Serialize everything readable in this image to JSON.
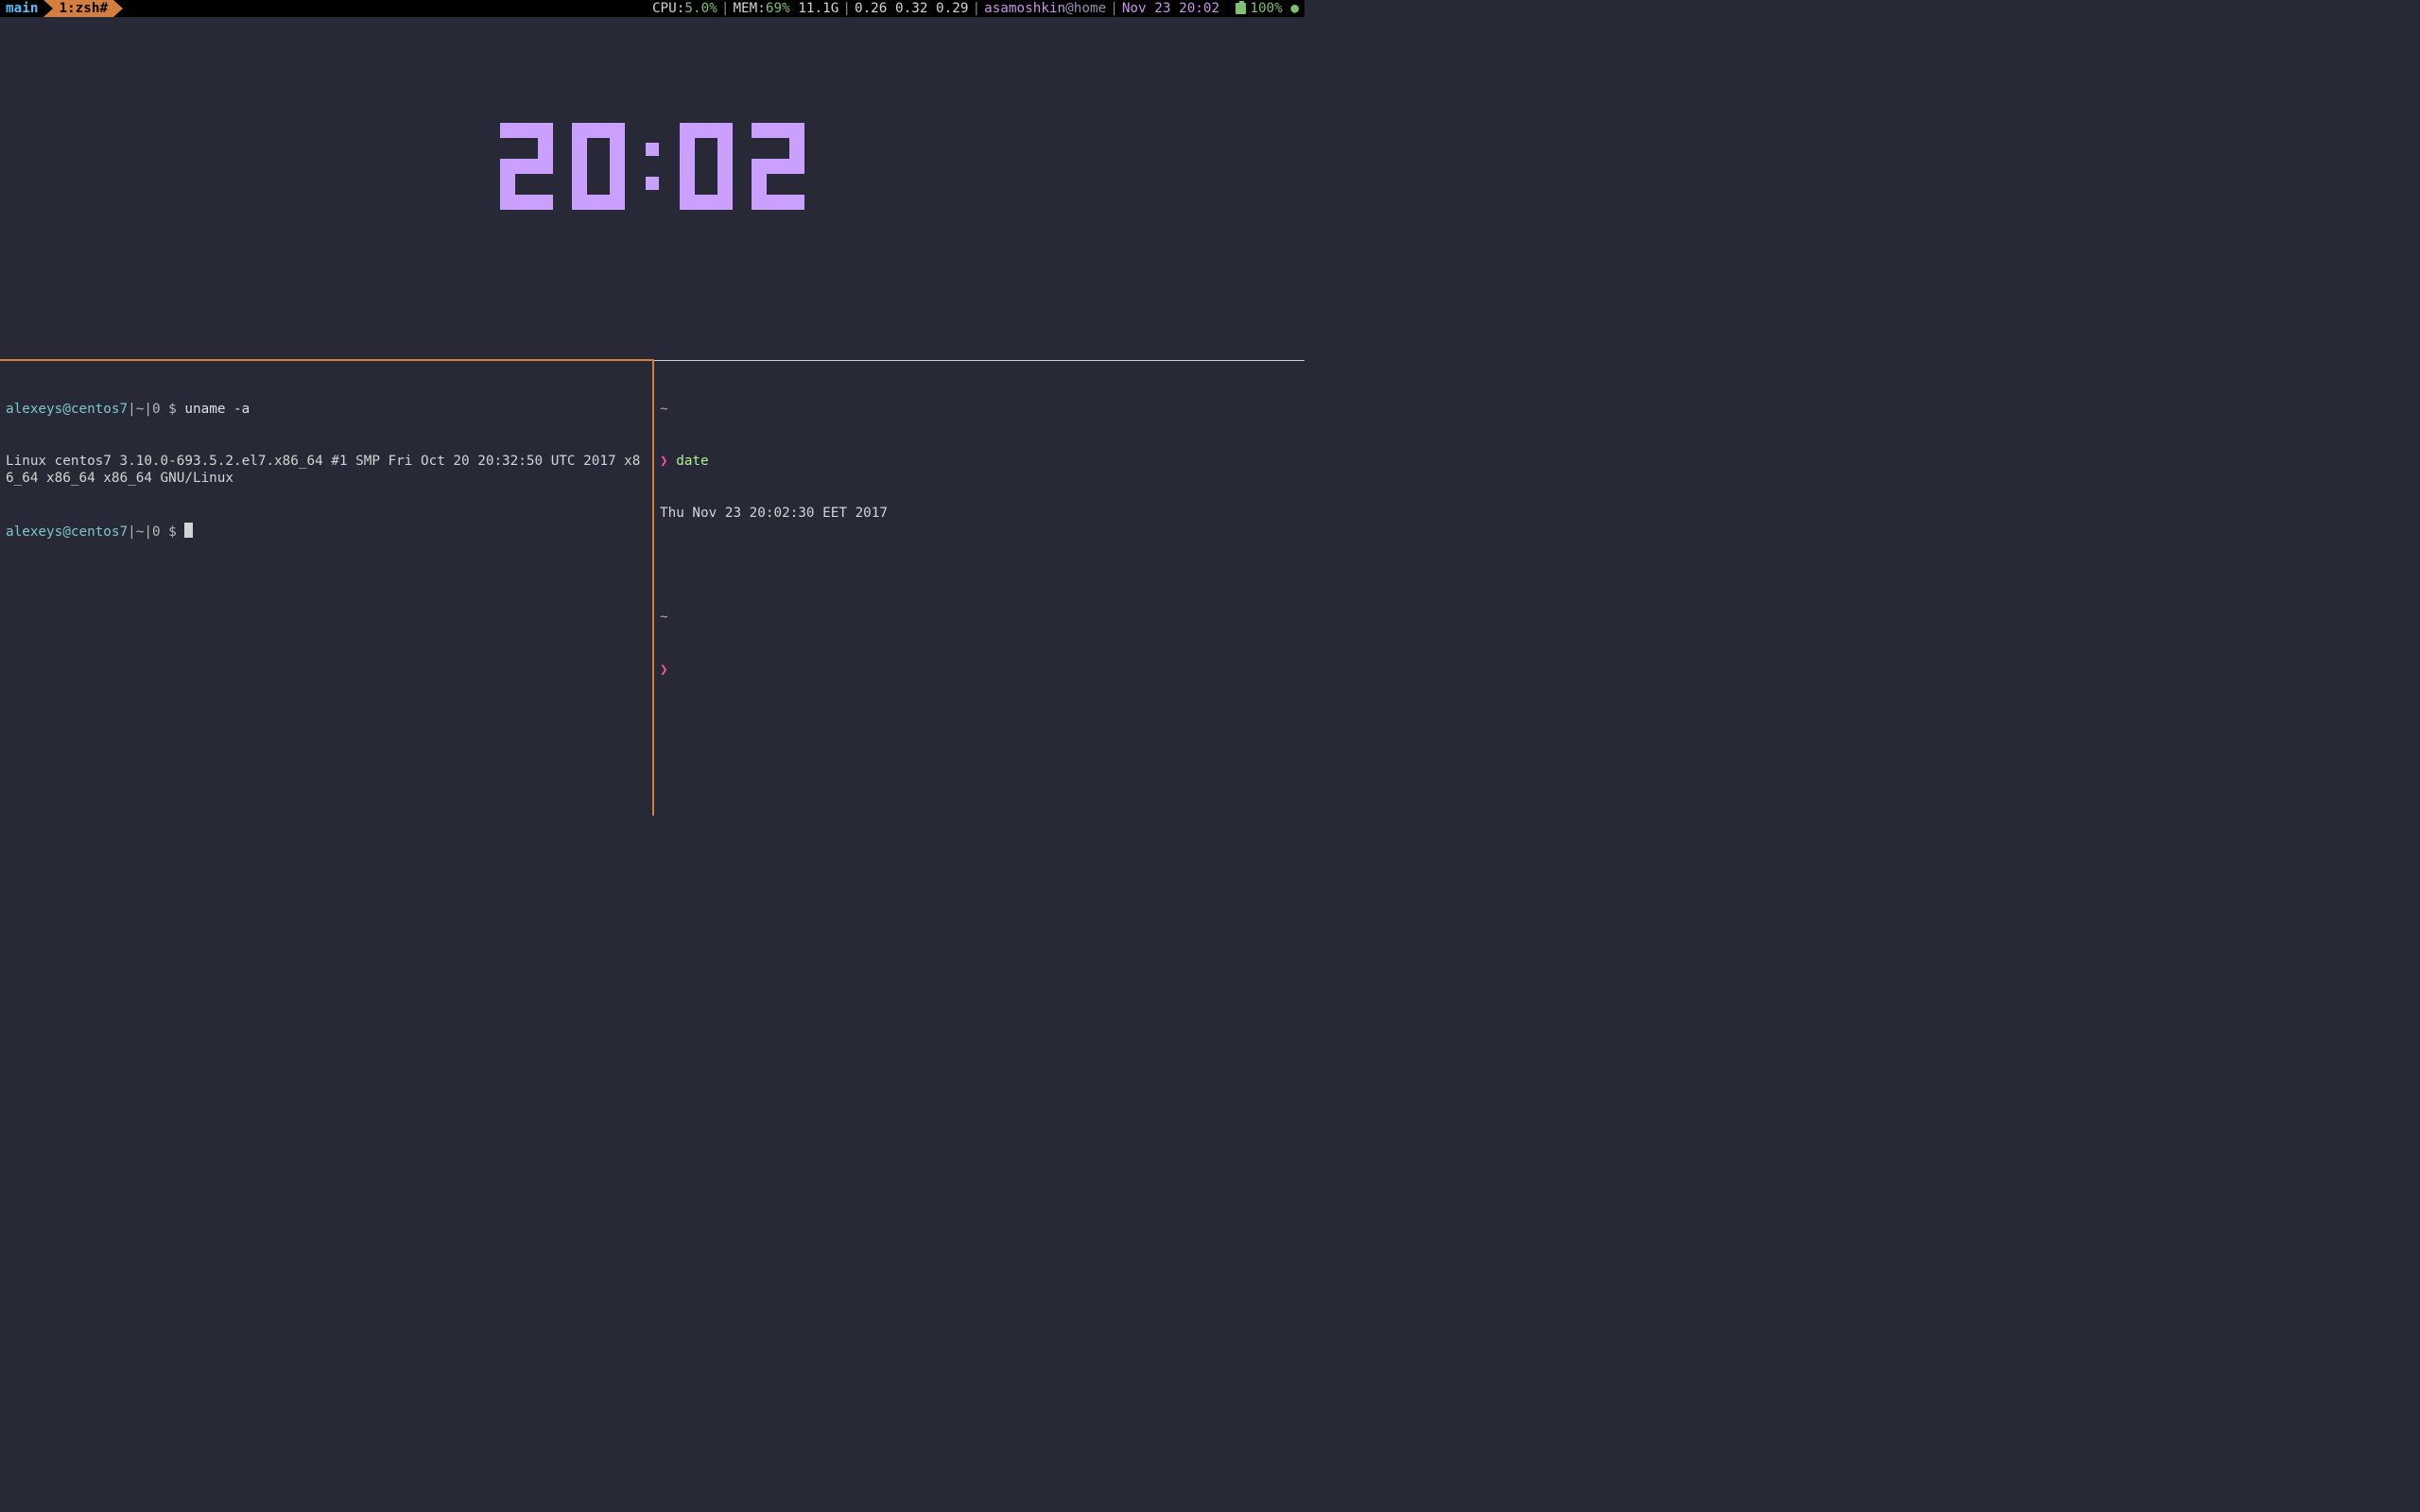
{
  "statusbar": {
    "session": "main",
    "window": "1:zsh#",
    "cpu_label": "CPU:",
    "cpu_value": "5.0%",
    "mem_label": "MEM:",
    "mem_pct": "69%",
    "mem_size": "11.1G",
    "load": "0.26 0.32 0.29",
    "user": "asamoshkin",
    "host": "@home",
    "datetime": "Nov 23 20:02",
    "battery": "100%",
    "sep": "|",
    "dot": "●"
  },
  "clock": {
    "h1": "2",
    "h2": "0",
    "m1": "0",
    "m2": "2"
  },
  "left_pane": {
    "prompt1_user": "alexeys@centos7",
    "prompt1_sep": "|~|0 $ ",
    "cmd1": "uname -a",
    "output1": "Linux centos7 3.10.0-693.5.2.el7.x86_64 #1 SMP Fri Oct 20 20:32:50 UTC 2017 x86_64 x86_64 x86_64 GNU/Linux",
    "prompt2_user": "alexeys@centos7",
    "prompt2_sep": "|~|0 $ "
  },
  "right_pane": {
    "tilde": "~",
    "angle": "❯",
    "cmd": "date",
    "output": "Thu Nov 23 20:02:30 EET 2017"
  }
}
